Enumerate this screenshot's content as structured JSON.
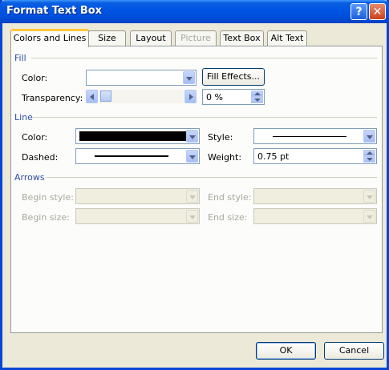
{
  "window": {
    "title": "Format Text Box"
  },
  "titlebar_buttons": {
    "help": "?",
    "close": "✕"
  },
  "tabs": [
    {
      "label": "Colors and Lines",
      "active": true
    },
    {
      "label": "Size"
    },
    {
      "label": "Layout"
    },
    {
      "label": "Picture",
      "disabled": true
    },
    {
      "label": "Text Box"
    },
    {
      "label": "Alt Text"
    }
  ],
  "fill": {
    "section": "Fill",
    "color_label": "Color:",
    "color_value": "",
    "fill_effects_button": "Fill Effects...",
    "transparency_label": "Transparency:",
    "transparency_value": "0 %"
  },
  "line": {
    "section": "Line",
    "color_label": "Color:",
    "color_value_hex": "#000000",
    "dashed_label": "Dashed:",
    "style_label": "Style:",
    "weight_label": "Weight:",
    "weight_value": "0.75 pt"
  },
  "arrows": {
    "section": "Arrows",
    "begin_style_label": "Begin style:",
    "end_style_label": "End style:",
    "begin_size_label": "Begin size:",
    "end_size_label": "End size:"
  },
  "buttons": {
    "ok": "OK",
    "cancel": "Cancel"
  },
  "colors": {
    "titlebar": "#0055e5",
    "section_text": "#2f4fa8",
    "tab_active_accent": "#ffc83c"
  }
}
